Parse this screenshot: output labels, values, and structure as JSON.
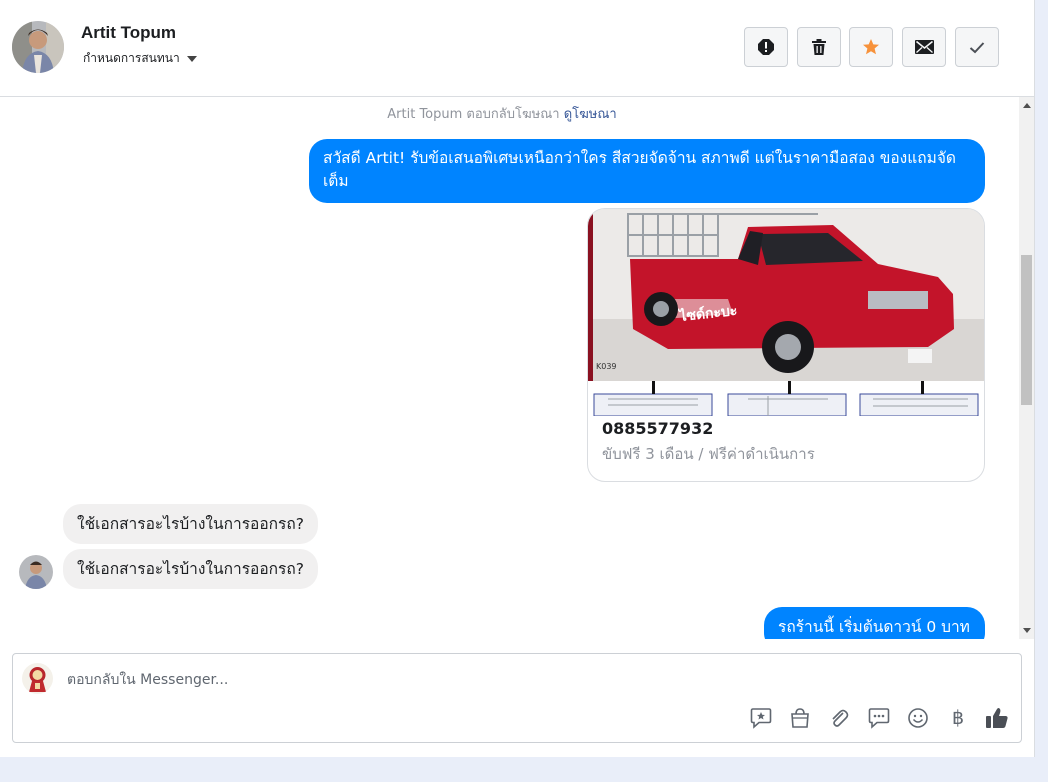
{
  "header": {
    "contact_name": "Artit Topum",
    "settings_label": "กำหนดการสนทนา",
    "actions": [
      {
        "id": "spam",
        "icon": "alert-icon"
      },
      {
        "id": "delete",
        "icon": "trash-icon"
      },
      {
        "id": "star",
        "icon": "star-icon",
        "color": "#f7923b"
      },
      {
        "id": "unread",
        "icon": "envelope-icon"
      },
      {
        "id": "done",
        "icon": "check-icon"
      }
    ]
  },
  "thread": {
    "ad_reply_text": "Artit Topum ตอบกลับโฆษณา",
    "ad_link": "ดูโฆษณา",
    "greeting": "สวัสดี Artit! รับข้อเสนอพิเศษเหนือกว่าใคร สีสวยจัดจ้าน สภาพดี แต่ในราคามือสอง ของแถมจัดเต็ม",
    "card": {
      "title": "0885577932",
      "subtitle": "ขับฟรี 3 เดือน / ฟรีค่าดำเนินการ",
      "image_stock_code": "K039",
      "image_brand_text": "ไซด์กะบะ"
    },
    "incoming": [
      "ใช้เอกสารอะไรบ้างในการออกรถ?",
      "ใช้เอกสารอะไรบ้างในการออกรถ?"
    ],
    "outgoing_last": "รถร้านนี้ เริ่มต้นดาวน์ 0 บาท"
  },
  "composer": {
    "placeholder": "ตอบกลับใน Messenger...",
    "tools": [
      "sticker-icon",
      "shop-icon",
      "attachment-icon",
      "saved-reply-icon",
      "emoji-icon",
      "baht-icon",
      "thumbs-up-icon"
    ],
    "baht_symbol": "฿"
  },
  "colors": {
    "accent": "#0084ff",
    "bubble_in": "#f1f0f0",
    "star": "#f7923b"
  }
}
